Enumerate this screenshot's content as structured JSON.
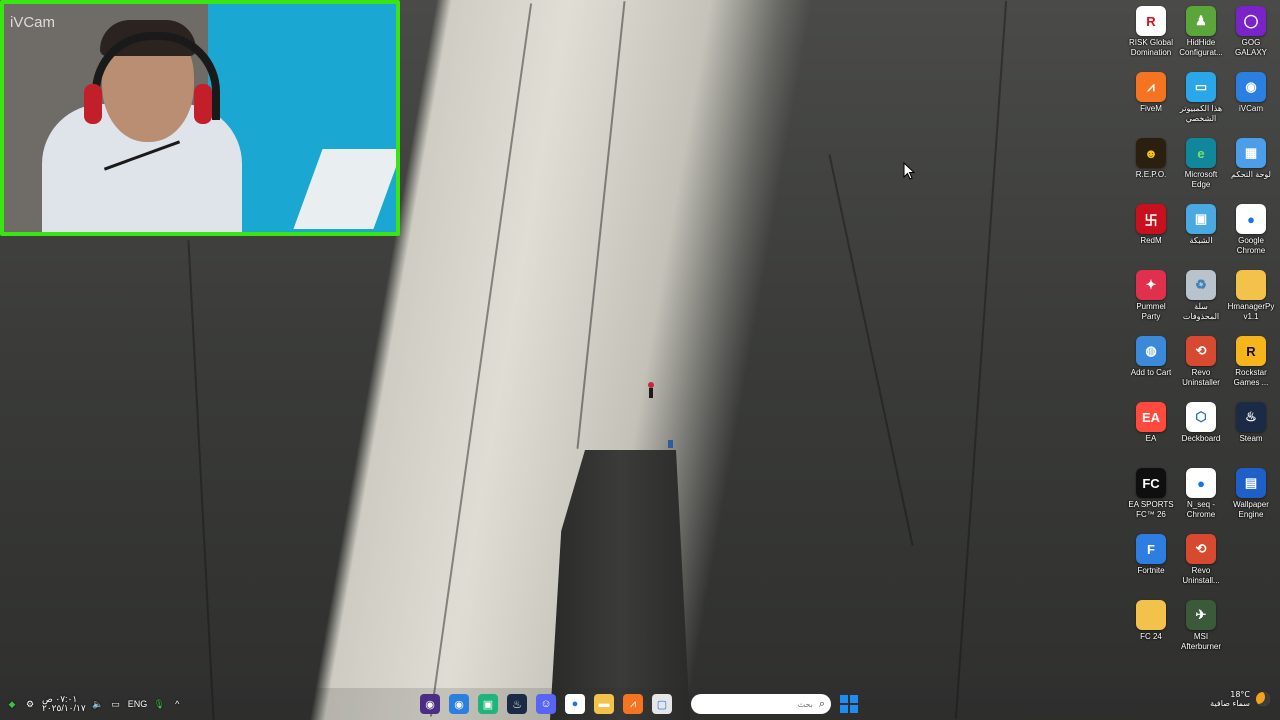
{
  "webcam": {
    "label": "iVCam"
  },
  "desktop_icons": [
    {
      "label": "RISK Global Domination",
      "icon": "risk-icon",
      "color": "#ffffff",
      "glyph": "R",
      "fg": "#d9121b"
    },
    {
      "label": "HidHide Configurat...",
      "icon": "hidhide-icon",
      "color": "#5aa63a",
      "glyph": "♟",
      "fg": "#ffffff"
    },
    {
      "label": "GOG GALAXY",
      "icon": "gog-galaxy-icon",
      "color": "#7a23c9",
      "glyph": "◯",
      "fg": "#ffffff"
    },
    {
      "label": "FiveM",
      "icon": "fivem-icon",
      "color": "#f47421",
      "glyph": "⩘",
      "fg": "#ffffff"
    },
    {
      "label": "هذا الكمبيوتر الشخصي",
      "icon": "this-pc-icon",
      "color": "#2aa7e8",
      "glyph": "▭",
      "fg": "#ffffff"
    },
    {
      "label": "iVCam",
      "icon": "ivcam-icon",
      "color": "#2b7fe0",
      "glyph": "◉",
      "fg": "#ffffff"
    },
    {
      "label": "R.E.P.O.",
      "icon": "repo-icon",
      "color": "#2b2010",
      "glyph": "☻",
      "fg": "#f2c21b"
    },
    {
      "label": "Microsoft Edge",
      "icon": "edge-icon",
      "color": "#11879b",
      "glyph": "e",
      "fg": "#7ee06a"
    },
    {
      "label": "لوحة التحكم",
      "icon": "control-panel-icon",
      "color": "#4c9ee8",
      "glyph": "▦",
      "fg": "#ffffff"
    },
    {
      "label": "RedM",
      "icon": "redm-icon",
      "color": "#c8101e",
      "glyph": "卐",
      "fg": "#ffffff"
    },
    {
      "label": "الشبكة",
      "icon": "network-icon",
      "color": "#49a9e0",
      "glyph": "▣",
      "fg": "#ffffff"
    },
    {
      "label": "Google Chrome",
      "icon": "chrome-icon",
      "color": "#ffffff",
      "glyph": "●",
      "fg": "#1a73e8"
    },
    {
      "label": "Pummel Party",
      "icon": "pummel-party-icon",
      "color": "#e0304e",
      "glyph": "✦",
      "fg": "#ffffff"
    },
    {
      "label": "سلة المحذوفات",
      "icon": "recycle-bin-icon",
      "color": "#b9c3cc",
      "glyph": "♻",
      "fg": "#3d7fb9"
    },
    {
      "label": "HmanagerPy v1.1",
      "icon": "folder-icon",
      "color": "#f2c24b",
      "glyph": "",
      "fg": "#ffffff"
    },
    {
      "label": "Add to Cart",
      "icon": "add-to-cart-icon",
      "color": "#3b8ad9",
      "glyph": "◍",
      "fg": "#ffffff"
    },
    {
      "label": "Revo Uninstaller",
      "icon": "revo-uninstaller-icon",
      "color": "#d84a2f",
      "glyph": "⟲",
      "fg": "#ffffff"
    },
    {
      "label": "Rockstar Games ...",
      "icon": "rockstar-icon",
      "color": "#f6b51a",
      "glyph": "R",
      "fg": "#111111"
    },
    {
      "label": "EA",
      "icon": "ea-icon",
      "color": "#ff4a3d",
      "glyph": "EA",
      "fg": "#ffffff"
    },
    {
      "label": "Deckboard",
      "icon": "deckboard-icon",
      "color": "#ffffff",
      "glyph": "⬡",
      "fg": "#2a6cc0"
    },
    {
      "label": "Steam",
      "icon": "steam-icon",
      "color": "#1b2a45",
      "glyph": "♨",
      "fg": "#ffffff"
    },
    {
      "label": "EA SPORTS FC™ 26",
      "icon": "ea-sports-fc-icon",
      "color": "#0f0f0f",
      "glyph": "FC",
      "fg": "#ffffff"
    },
    {
      "label": "N_seq - Chrome",
      "icon": "chrome-icon",
      "color": "#ffffff",
      "glyph": "●",
      "fg": "#1a73e8"
    },
    {
      "label": "Wallpaper Engine",
      "icon": "wallpaper-engine-icon",
      "color": "#1f5fc8",
      "glyph": "▤",
      "fg": "#ffffff"
    },
    {
      "label": "Fortnite",
      "icon": "fortnite-icon",
      "color": "#2e7de0",
      "glyph": "F",
      "fg": "#ffffff"
    },
    {
      "label": "Revo Uninstall...",
      "icon": "revo-uninstaller-icon",
      "color": "#d84a2f",
      "glyph": "⟲",
      "fg": "#ffffff"
    },
    {
      "label": "",
      "icon": "empty-slot",
      "color": "transparent",
      "glyph": "",
      "fg": "#ffffff"
    },
    {
      "label": "FC 24",
      "icon": "folder-icon",
      "color": "#f2c24b",
      "glyph": "",
      "fg": "#ffffff"
    },
    {
      "label": "MSI Afterburner",
      "icon": "msi-afterburner-icon",
      "color": "#3a5a3a",
      "glyph": "✈",
      "fg": "#ffffff"
    }
  ],
  "taskbar": {
    "clock_time": "٠٧:٠١ ص",
    "clock_date": "٢٠٢٥/١٠/١٧",
    "language": "ENG",
    "search_placeholder": "بحث",
    "weather_temp": "18°C",
    "weather_desc": "سماء صافية",
    "apps": [
      {
        "name": "obs-icon",
        "color": "#4b2e83",
        "glyph": "◉"
      },
      {
        "name": "ivcam-icon",
        "color": "#2b7fe0",
        "glyph": "◉"
      },
      {
        "name": "app-green-icon",
        "color": "#1fb57a",
        "glyph": "▣"
      },
      {
        "name": "steam-icon",
        "color": "#1b2a45",
        "glyph": "♨"
      },
      {
        "name": "discord-icon",
        "color": "#5865f2",
        "glyph": "☺"
      },
      {
        "name": "chrome-icon",
        "color": "#ffffff",
        "glyph": "●"
      },
      {
        "name": "file-explorer-icon",
        "color": "#f2c24b",
        "glyph": "▬"
      },
      {
        "name": "fivem-icon",
        "color": "#f47421",
        "glyph": "⩘"
      },
      {
        "name": "task-view-icon",
        "color": "#e6e6e6",
        "glyph": "▢"
      }
    ]
  }
}
